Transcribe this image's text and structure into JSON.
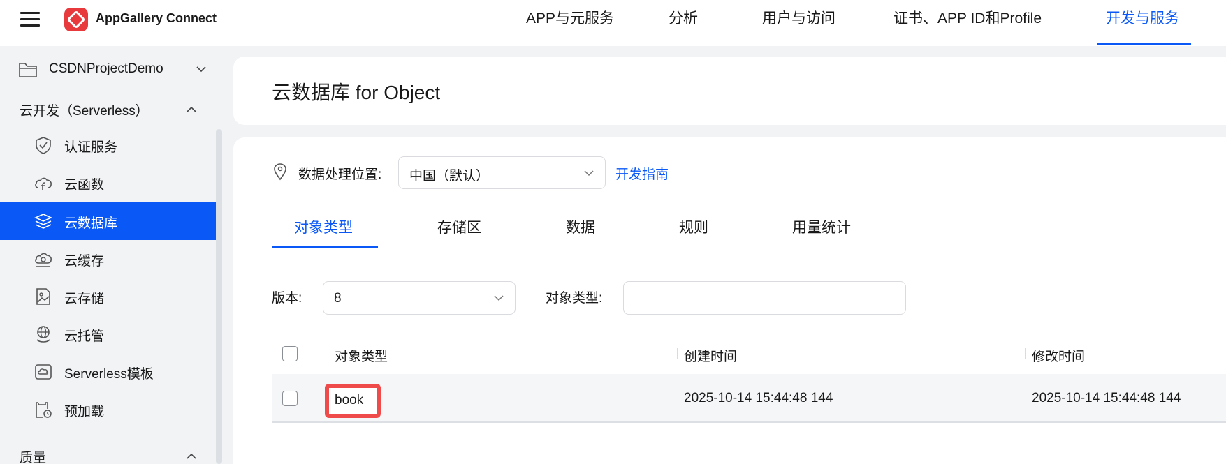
{
  "brand": {
    "name": "AppGallery Connect",
    "accent": "#0a59f7",
    "logo_color": "#e8393d"
  },
  "topnav": [
    {
      "label": "APP与元服务",
      "active": false
    },
    {
      "label": "分析",
      "active": false
    },
    {
      "label": "用户与访问",
      "active": false
    },
    {
      "label": "证书、APP ID和Profile",
      "active": false
    },
    {
      "label": "开发与服务",
      "active": true
    }
  ],
  "sidebar": {
    "project": "CSDNProjectDemo",
    "group_serverless": "云开发（Serverless）",
    "items": [
      {
        "label": "认证服务",
        "icon": "shield-icon",
        "active": false
      },
      {
        "label": "云函数",
        "icon": "cloud-function-icon",
        "active": false
      },
      {
        "label": "云数据库",
        "icon": "database-layers-icon",
        "active": true
      },
      {
        "label": "云缓存",
        "icon": "cloud-cache-icon",
        "active": false
      },
      {
        "label": "云存储",
        "icon": "storage-image-icon",
        "active": false
      },
      {
        "label": "云托管",
        "icon": "globe-hand-icon",
        "active": false
      },
      {
        "label": "Serverless模板",
        "icon": "template-icon",
        "active": false
      },
      {
        "label": "预加载",
        "icon": "preload-clock-icon",
        "active": false
      }
    ],
    "group_quality": "质量"
  },
  "main": {
    "title": "云数据库 for Object",
    "location_label": "数据处理位置:",
    "location_value": "中国（默认）",
    "dev_guide_link": "开发指南",
    "tabs": [
      {
        "label": "对象类型",
        "active": true
      },
      {
        "label": "存储区",
        "active": false
      },
      {
        "label": "数据",
        "active": false
      },
      {
        "label": "规则",
        "active": false
      },
      {
        "label": "用量统计",
        "active": false
      }
    ],
    "version_label": "版本:",
    "version_value": "8",
    "type_filter_label": "对象类型:",
    "type_filter_value": "",
    "table": {
      "headers": [
        "对象类型",
        "创建时间",
        "修改时间"
      ],
      "rows": [
        {
          "type": "book",
          "created": "2025-10-14 15:44:48 144",
          "modified": "2025-10-14 15:44:48 144"
        }
      ]
    }
  }
}
